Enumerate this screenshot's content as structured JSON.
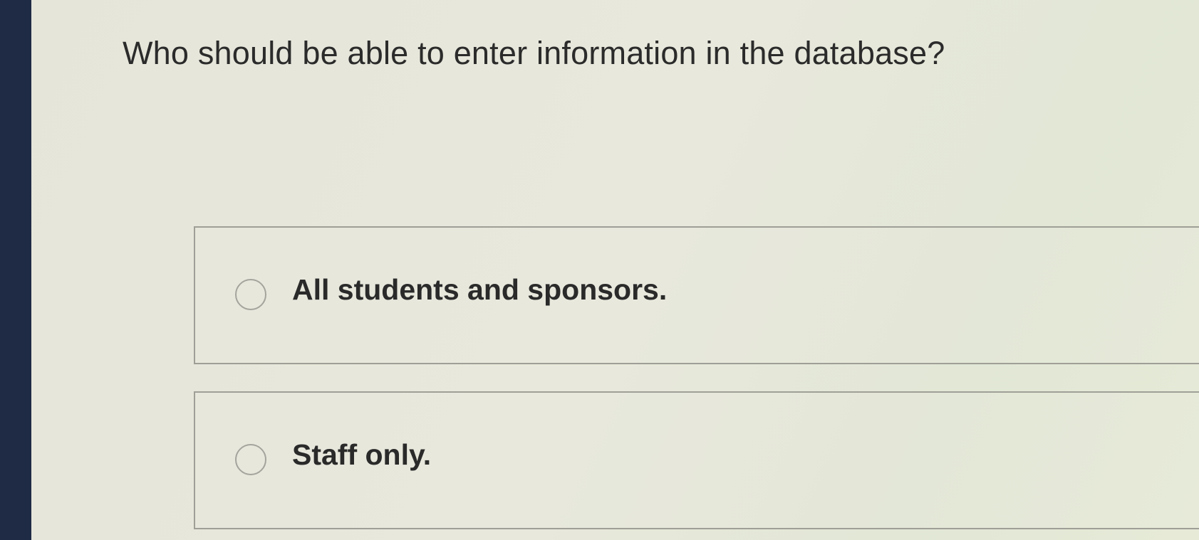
{
  "question": {
    "text": "Who should be able to enter information in the database?"
  },
  "options": [
    {
      "label": "All students and sponsors.",
      "selected": false
    },
    {
      "label": "Staff only.",
      "selected": false
    }
  ],
  "colors": {
    "page_background": "#e6e6db",
    "left_edge": "#1f2a44",
    "border": "#9f9f97",
    "text": "#2b2b2b"
  }
}
